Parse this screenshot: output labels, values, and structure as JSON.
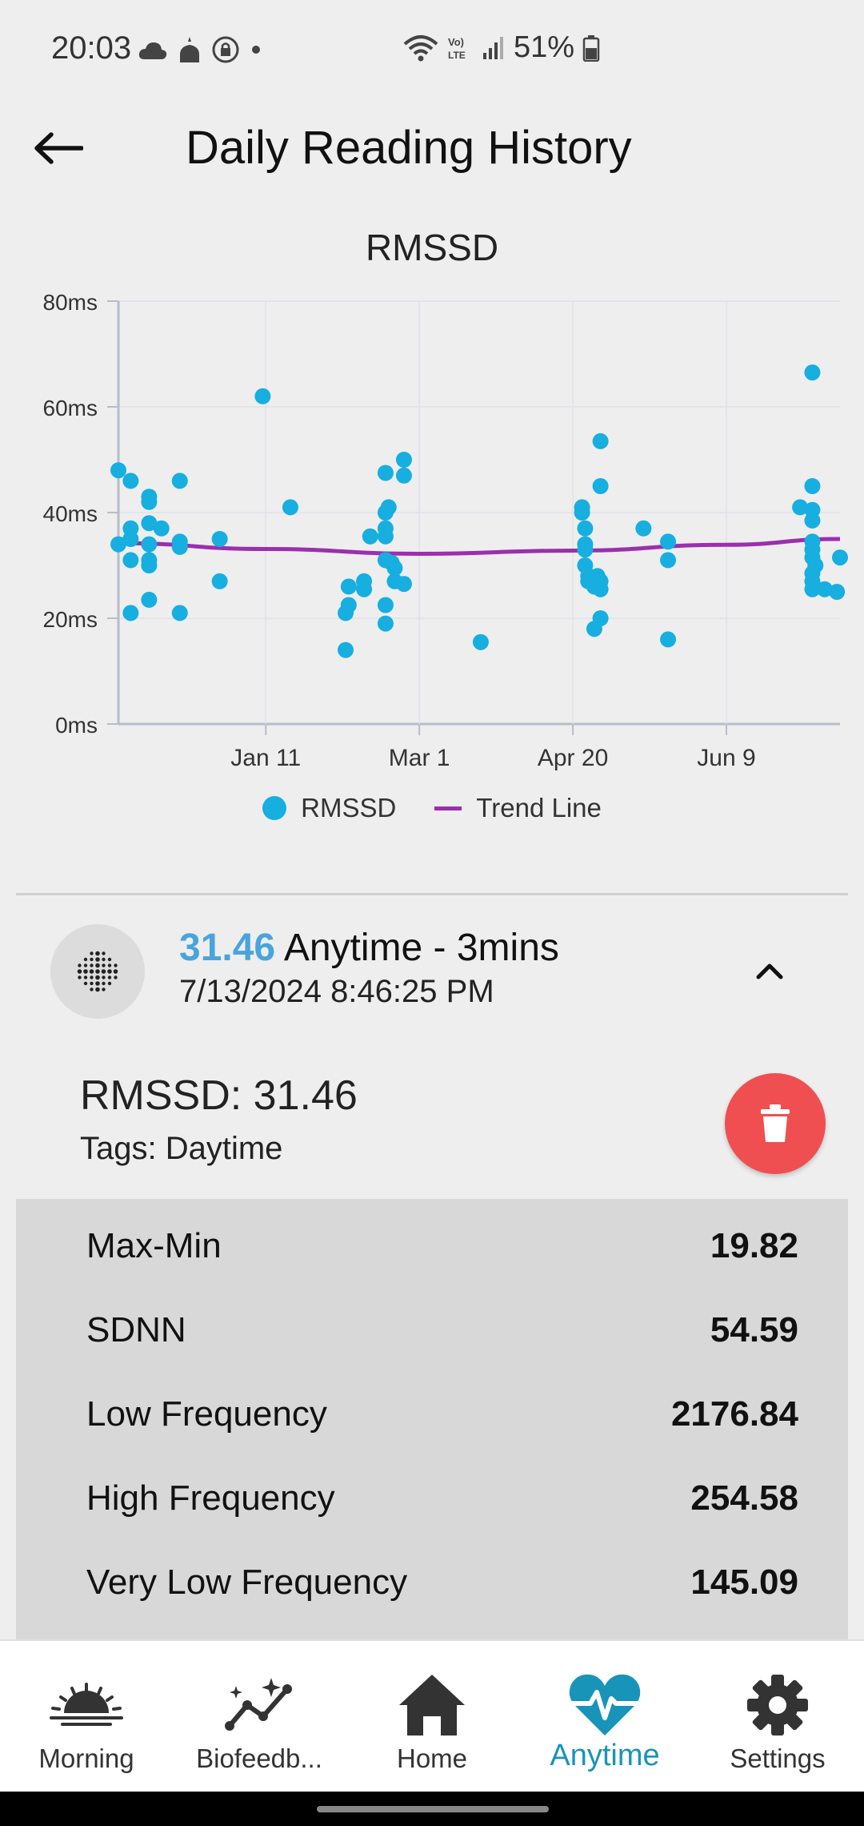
{
  "status_bar": {
    "time": "20:03",
    "battery": "51%"
  },
  "header": {
    "title": "Daily Reading History"
  },
  "chart_data": {
    "type": "scatter",
    "title": "RMSSD",
    "y_ticks": [
      "0ms",
      "20ms",
      "40ms",
      "60ms",
      "80ms"
    ],
    "x_ticks": [
      "Jan 11",
      "Mar 1",
      "Apr 20",
      "Jun 9"
    ],
    "ylim": [
      0,
      80
    ],
    "xlim": [
      "Nov 24",
      "Jul 16"
    ],
    "grid": true,
    "legend_position": "bottom",
    "series": [
      {
        "name": "RMSSD",
        "color": "#17aee0",
        "points": [
          [
            "Nov 24",
            48
          ],
          [
            "Nov 24",
            34
          ],
          [
            "Nov 28",
            46
          ],
          [
            "Nov 28",
            37
          ],
          [
            "Nov 28",
            35
          ],
          [
            "Nov 28",
            31
          ],
          [
            "Nov 28",
            21
          ],
          [
            "Dec 4",
            43
          ],
          [
            "Dec 4",
            42
          ],
          [
            "Dec 4",
            38
          ],
          [
            "Dec 4",
            34
          ],
          [
            "Dec 4",
            31
          ],
          [
            "Dec 4",
            30
          ],
          [
            "Dec 4",
            23.5
          ],
          [
            "Dec 8",
            37
          ],
          [
            "Dec 14",
            46
          ],
          [
            "Dec 14",
            34.5
          ],
          [
            "Dec 14",
            33.5
          ],
          [
            "Dec 14",
            21
          ],
          [
            "Dec 27",
            35
          ],
          [
            "Dec 27",
            27
          ],
          [
            "Jan 10",
            62
          ],
          [
            "Jan 19",
            41
          ],
          [
            "Feb 6",
            21
          ],
          [
            "Feb 6",
            14
          ],
          [
            "Feb 7",
            26
          ],
          [
            "Feb 7",
            22.5
          ],
          [
            "Feb 12",
            27
          ],
          [
            "Feb 12",
            25.5
          ],
          [
            "Feb 14",
            35.5
          ],
          [
            "Feb 19",
            47.5
          ],
          [
            "Feb 19",
            40
          ],
          [
            "Feb 19",
            37
          ],
          [
            "Feb 19",
            35.5
          ],
          [
            "Feb 19",
            31
          ],
          [
            "Feb 19",
            22.5
          ],
          [
            "Feb 19",
            19
          ],
          [
            "Feb 20",
            41
          ],
          [
            "Feb 21",
            30.5
          ],
          [
            "Feb 22",
            29.5
          ],
          [
            "Feb 22",
            27
          ],
          [
            "Feb 25",
            50
          ],
          [
            "Feb 25",
            47
          ],
          [
            "Feb 25",
            26.5
          ],
          [
            "Mar 21",
            15.5
          ],
          [
            "Apr 23",
            41
          ],
          [
            "Apr 23",
            40
          ],
          [
            "Apr 24",
            37
          ],
          [
            "Apr 24",
            34
          ],
          [
            "Apr 24",
            33
          ],
          [
            "Apr 24",
            30
          ],
          [
            "Apr 25",
            28
          ],
          [
            "Apr 25",
            27
          ],
          [
            "Apr 27",
            26
          ],
          [
            "Apr 27",
            18
          ],
          [
            "Apr 28",
            28
          ],
          [
            "Apr 29",
            27
          ],
          [
            "Apr 29",
            25.5
          ],
          [
            "Apr 29",
            20
          ],
          [
            "Apr 29",
            45
          ],
          [
            "Apr 29",
            53.5
          ],
          [
            "May 13",
            37
          ],
          [
            "May 21",
            34.5
          ],
          [
            "May 21",
            31
          ],
          [
            "May 21",
            16
          ],
          [
            "Jul 3",
            41
          ],
          [
            "Jul 7",
            66.5
          ],
          [
            "Jul 7",
            45
          ],
          [
            "Jul 7",
            40.5
          ],
          [
            "Jul 7",
            38.5
          ],
          [
            "Jul 7",
            34.5
          ],
          [
            "Jul 7",
            33
          ],
          [
            "Jul 7",
            31.5
          ],
          [
            "Jul 7",
            28.5
          ],
          [
            "Jul 7",
            27
          ],
          [
            "Jul 7",
            25.5
          ],
          [
            "Jul 8",
            30
          ],
          [
            "Jul 11",
            25.5
          ],
          [
            "Jul 15",
            25
          ],
          [
            "Jul 16",
            31.5
          ]
        ]
      },
      {
        "name": "Trend Line",
        "color": "#9b2fae",
        "points": [
          [
            "Nov 24",
            34.2
          ],
          [
            "Jan 11",
            33.1
          ],
          [
            "Mar 1",
            32.2
          ],
          [
            "Apr 20",
            32.8
          ],
          [
            "Jun 9",
            33.9
          ],
          [
            "Jul 16",
            35
          ]
        ]
      }
    ]
  },
  "legend": {
    "rmssd": "RMSSD",
    "trend": "Trend Line"
  },
  "reading": {
    "value": "31.46",
    "title": "Anytime - 3mins",
    "datetime": "7/13/2024 8:46:25 PM",
    "rmssd_line": "RMSSD: 31.46",
    "tags_line": "Tags: Daytime"
  },
  "metrics": [
    {
      "label": "Max-Min",
      "value": "19.82"
    },
    {
      "label": "SDNN",
      "value": "54.59"
    },
    {
      "label": "Low Frequency",
      "value": "2176.84"
    },
    {
      "label": "High Frequency",
      "value": "254.58"
    },
    {
      "label": "Very Low Frequency",
      "value": "145.09"
    }
  ],
  "nav": [
    {
      "label": "Morning",
      "icon": "sunrise-icon",
      "active": false
    },
    {
      "label": "Biofeedb...",
      "icon": "sparkle-chart-icon",
      "active": false
    },
    {
      "label": "Home",
      "icon": "home-icon",
      "active": false
    },
    {
      "label": "Anytime",
      "icon": "heartbeat-icon",
      "active": true
    },
    {
      "label": "Settings",
      "icon": "gear-icon",
      "active": false
    }
  ],
  "colors": {
    "accent": "#1994b9",
    "dot": "#17aee0",
    "trend": "#9b2fae",
    "delete": "#ef4f50"
  }
}
